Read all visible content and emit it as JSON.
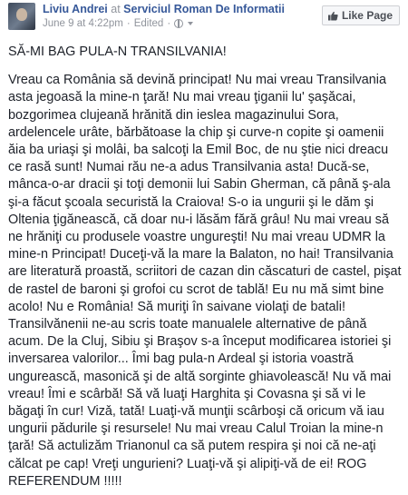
{
  "post": {
    "author": "Liviu Andrei",
    "at_word": "at",
    "location": "Serviciul Roman De Informatii",
    "date": "June 9 at 4:22pm",
    "separator": "·",
    "edited": "Edited",
    "separator2": "·",
    "like_page_label": "Like Page"
  },
  "content": {
    "title": "SĂ-MI BAG PULA-N TRANSILVANIA!",
    "paragraph": "Vreau ca România să devină principat! Nu mai vreau Transilvania asta jegoasă la mine-n ţară! Nu mai vreau ţiganii lu' şaşăcai, bozgorimea clujeană hrănită din ieslea magazinului Sora, ardelencele urâte, bărbătoase la chip şi curve-n copite şi oamenii ăia ba uriaşi şi molâi, ba salcoţi la Emil Boc, de nu ştie nici dreacu ce rasă sunt! Numai rău ne-a adus Transilvania asta! Ducă-se, mânca-o-ar dracii şi toţi demonii lui Sabin Gherman, că până ş-ala şi-a făcut şcoala securistă la Craiova! S-o ia ungurii şi le dăm şi Oltenia ţigănească, că doar nu-i lăsăm fără grâu! Nu mai vreau să ne hrăniţi cu produsele voastre ungureşti! Nu mai vreau UDMR la mine-n Principat! Duceţi-vă la mare la Balaton, no hai! Transilvania are literatură proastă, scriitori de cazan din căscaturi de castel, pişat de rastel de baroni şi grofoi cu scrot de tablă! Eu nu mă simt bine acolo! Nu e România! Să muriţi în saivane violaţi de batali! Transilvănenii ne-au scris toate manualele alternative de până acum. De la Cluj, Sibiu şi Braşov s-a început modificarea istoriei şi inversarea valorilor... Îmi bag pula-n Ardeal şi istoria voastră ungurească, masonică şi de altă sorginte ghiavolească! Nu vă mai vreau! Îmi e scârbă! Să vă luaţi Harghita şi Covasna şi să vi le băgaţi în cur! Vizǎ, tată! Luaţi-vă munţii scârboşi că oricum vă iau ungurii pădurile şi resursele! Nu mai vreau Calul Troian la mine-n ţară! Să actulizăm Trianonul ca să putem respira şi noi că ne-aţi călcat pe cap! Vreţi ungurieni? Luaţi-vă şi alipiţi-vă de ei! ROG REFERENDUM !!!!!"
  },
  "colors": {
    "link": "#365899",
    "meta": "#90949c",
    "text": "#1d2129",
    "button_bg": "#f6f7f9"
  },
  "icons": {
    "avatar": "profile-photo",
    "audience": "globe-icon",
    "dropdown": "chevron-down-icon",
    "like": "thumbs-up-icon"
  }
}
